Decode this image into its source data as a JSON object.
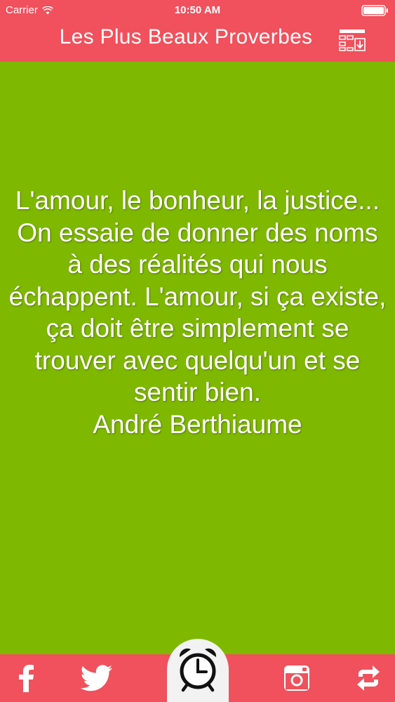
{
  "status_bar": {
    "carrier": "Carrier",
    "time": "10:50 AM",
    "icons": [
      "wifi-icon",
      "battery-icon"
    ]
  },
  "nav": {
    "title": "Les Plus Beaux Proverbes",
    "right_icon": "list-download-icon"
  },
  "quote": {
    "text": "L'amour, le bonheur, la justice... On essaie de donner des noms à des réalités qui nous échappent. L'amour, si ça existe, ça doit être simplement se trouver avec quelqu'un et se sentir bien.",
    "author": "André Berthiaume"
  },
  "tabbar": {
    "items": [
      {
        "icon": "facebook-icon"
      },
      {
        "icon": "twitter-icon"
      },
      {
        "icon": "alarm-clock-icon"
      },
      {
        "icon": "instagram-icon"
      },
      {
        "icon": "refresh-arrows-icon"
      }
    ]
  },
  "colors": {
    "accent": "#f0515c",
    "background": "#7fb800",
    "text": "#ffffff",
    "center_button": "#f2f2f2"
  }
}
